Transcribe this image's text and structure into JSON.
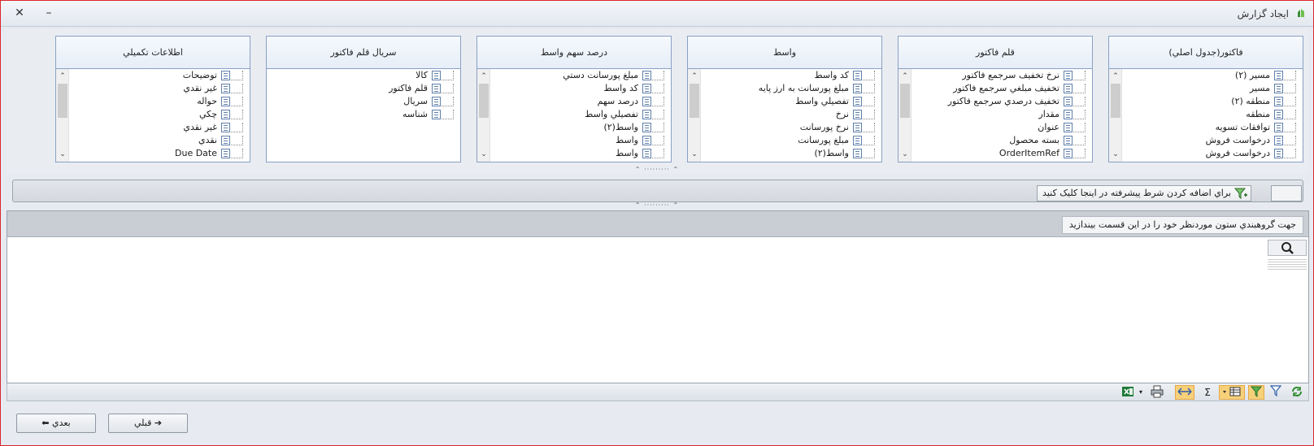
{
  "window": {
    "title": "ايجاد گزارش",
    "close_glyph": "✕",
    "minimize_glyph": "–"
  },
  "panels": [
    {
      "title": "فاکتور(جدول اصلي)",
      "items": [
        "مسير (۲)",
        "مسير",
        "منطقه (۲)",
        "منطقه",
        "توافقات تسويه",
        "درخواست فروش",
        "درخواست فروش"
      ]
    },
    {
      "title": "قلم فاکتور",
      "items": [
        "نرخ تخفيف سرجمع فاکتور",
        "تخفيف مبلغي سرجمع فاکتور",
        "تخفيف درصدي سرجمع فاکتور",
        "مقدار",
        "عنوان",
        "بسته محصول",
        "OrderItemRef"
      ]
    },
    {
      "title": "واسط",
      "items": [
        "کد واسط",
        "مبلغ پورسانت به ارز پايه",
        "تفصيلي واسط",
        "نرخ",
        "نرخ پورسانت",
        "مبلغ پورسانت",
        "واسط(۲)"
      ]
    },
    {
      "title": "درصد سهم واسط",
      "items": [
        "مبلغ پورسانت دستي",
        "کد واسط",
        "درصد سهم",
        "تفصيلي واسط",
        "واسط(۲)",
        "واسط",
        "واسط"
      ]
    },
    {
      "title": "سريال قلم فاکتور",
      "items": [
        "کالا",
        "قلم فاکتور",
        "سريال",
        "شناسه"
      ]
    },
    {
      "title": "اطلاعات تکميلي",
      "items": [
        "توضيحات",
        "غير نقدي",
        "حواله",
        "چکي",
        "غير نقدي",
        "نقدي",
        "Due Date"
      ]
    }
  ],
  "filter": {
    "button_label": "براي اضافه کردن شرط پيشرفته در اينجا کليک کنيد"
  },
  "grid": {
    "group_hint": "جهت گروهبندي ستون موردنظر خود را در اين قسمت بيندازيد"
  },
  "toolbar": {
    "icons": [
      "refresh-icon",
      "filter-icon",
      "filter-active-icon",
      "column-chooser-icon",
      "sum-icon",
      "fit-columns-icon",
      "print-icon",
      "export-excel-icon"
    ],
    "sum_glyph": "Σ"
  },
  "footer": {
    "prev_label": "قبلي",
    "next_label": "بعدي"
  },
  "colors": {
    "accent_active": "#f7d07a",
    "panel_border": "#8aa0c4",
    "title_close_border": "#d9262c"
  }
}
